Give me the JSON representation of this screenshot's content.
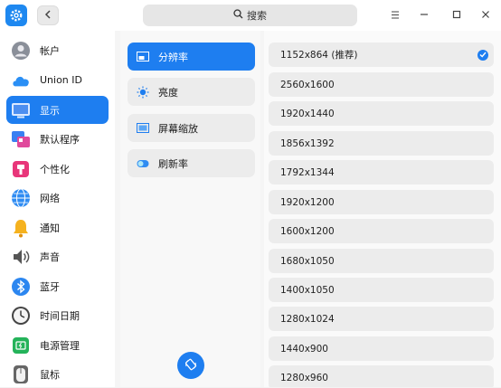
{
  "colors": {
    "accent": "#1e7ef0",
    "window_bg": "#f5f5f5"
  },
  "titlebar": {
    "app_icon": "settings-gear-icon",
    "back_icon": "chevron-left-icon",
    "search_placeholder": "搜索",
    "search_icon": "search-icon",
    "menu_icon": "menu-icon",
    "minimize_icon": "minimize-icon",
    "maximize_icon": "maximize-icon",
    "close_icon": "close-icon"
  },
  "sidebar": {
    "items": [
      {
        "label": "帐户",
        "icon": "account-icon"
      },
      {
        "label": "Union ID",
        "icon": "cloud-icon"
      },
      {
        "label": "显示",
        "icon": "display-icon",
        "active": true
      },
      {
        "label": "默认程序",
        "icon": "default-apps-icon"
      },
      {
        "label": "个性化",
        "icon": "personalization-icon"
      },
      {
        "label": "网络",
        "icon": "network-icon"
      },
      {
        "label": "通知",
        "icon": "bell-icon"
      },
      {
        "label": "声音",
        "icon": "speaker-icon"
      },
      {
        "label": "蓝牙",
        "icon": "bluetooth-icon"
      },
      {
        "label": "时间日期",
        "icon": "clock-icon"
      },
      {
        "label": "电源管理",
        "icon": "battery-icon"
      },
      {
        "label": "鼠标",
        "icon": "mouse-icon"
      }
    ]
  },
  "display_menu": {
    "items": [
      {
        "label": "分辨率",
        "icon": "resolution-icon",
        "active": true
      },
      {
        "label": "亮度",
        "icon": "brightness-icon"
      },
      {
        "label": "屏幕缩放",
        "icon": "scaling-icon"
      },
      {
        "label": "刷新率",
        "icon": "refresh-rate-icon"
      }
    ],
    "rotate_icon": "rotate-icon"
  },
  "resolutions": {
    "selected_index": 0,
    "items": [
      "1152x864 (推荐)",
      "2560x1600",
      "1920x1440",
      "1856x1392",
      "1792x1344",
      "1920x1200",
      "1600x1200",
      "1680x1050",
      "1400x1050",
      "1280x1024",
      "1440x900",
      "1280x960"
    ]
  }
}
